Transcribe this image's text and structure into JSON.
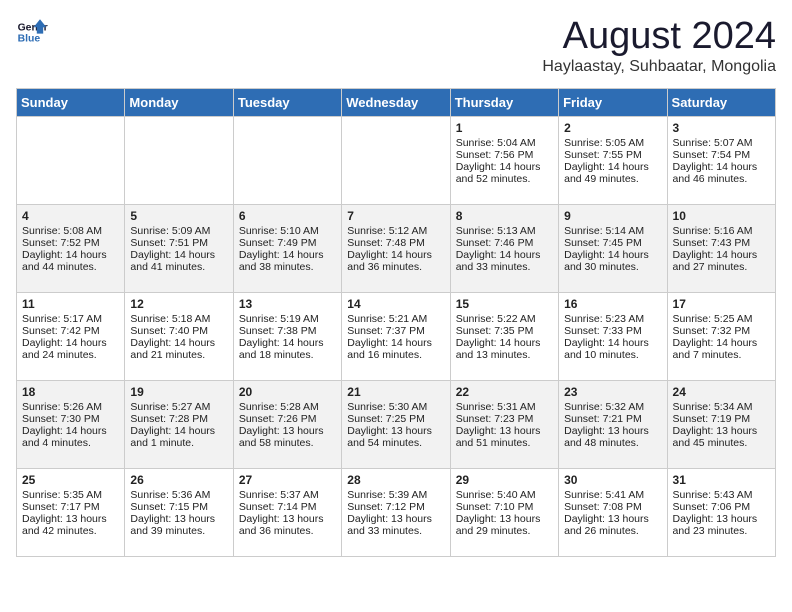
{
  "logo": {
    "line1": "General",
    "line2": "Blue"
  },
  "title": "August 2024",
  "subtitle": "Haylaastay, Suhbaatar, Mongolia",
  "weekdays": [
    "Sunday",
    "Monday",
    "Tuesday",
    "Wednesday",
    "Thursday",
    "Friday",
    "Saturday"
  ],
  "weeks": [
    [
      {
        "day": "",
        "info": ""
      },
      {
        "day": "",
        "info": ""
      },
      {
        "day": "",
        "info": ""
      },
      {
        "day": "",
        "info": ""
      },
      {
        "day": "1",
        "info": "Sunrise: 5:04 AM\nSunset: 7:56 PM\nDaylight: 14 hours\nand 52 minutes."
      },
      {
        "day": "2",
        "info": "Sunrise: 5:05 AM\nSunset: 7:55 PM\nDaylight: 14 hours\nand 49 minutes."
      },
      {
        "day": "3",
        "info": "Sunrise: 5:07 AM\nSunset: 7:54 PM\nDaylight: 14 hours\nand 46 minutes."
      }
    ],
    [
      {
        "day": "4",
        "info": "Sunrise: 5:08 AM\nSunset: 7:52 PM\nDaylight: 14 hours\nand 44 minutes."
      },
      {
        "day": "5",
        "info": "Sunrise: 5:09 AM\nSunset: 7:51 PM\nDaylight: 14 hours\nand 41 minutes."
      },
      {
        "day": "6",
        "info": "Sunrise: 5:10 AM\nSunset: 7:49 PM\nDaylight: 14 hours\nand 38 minutes."
      },
      {
        "day": "7",
        "info": "Sunrise: 5:12 AM\nSunset: 7:48 PM\nDaylight: 14 hours\nand 36 minutes."
      },
      {
        "day": "8",
        "info": "Sunrise: 5:13 AM\nSunset: 7:46 PM\nDaylight: 14 hours\nand 33 minutes."
      },
      {
        "day": "9",
        "info": "Sunrise: 5:14 AM\nSunset: 7:45 PM\nDaylight: 14 hours\nand 30 minutes."
      },
      {
        "day": "10",
        "info": "Sunrise: 5:16 AM\nSunset: 7:43 PM\nDaylight: 14 hours\nand 27 minutes."
      }
    ],
    [
      {
        "day": "11",
        "info": "Sunrise: 5:17 AM\nSunset: 7:42 PM\nDaylight: 14 hours\nand 24 minutes."
      },
      {
        "day": "12",
        "info": "Sunrise: 5:18 AM\nSunset: 7:40 PM\nDaylight: 14 hours\nand 21 minutes."
      },
      {
        "day": "13",
        "info": "Sunrise: 5:19 AM\nSunset: 7:38 PM\nDaylight: 14 hours\nand 18 minutes."
      },
      {
        "day": "14",
        "info": "Sunrise: 5:21 AM\nSunset: 7:37 PM\nDaylight: 14 hours\nand 16 minutes."
      },
      {
        "day": "15",
        "info": "Sunrise: 5:22 AM\nSunset: 7:35 PM\nDaylight: 14 hours\nand 13 minutes."
      },
      {
        "day": "16",
        "info": "Sunrise: 5:23 AM\nSunset: 7:33 PM\nDaylight: 14 hours\nand 10 minutes."
      },
      {
        "day": "17",
        "info": "Sunrise: 5:25 AM\nSunset: 7:32 PM\nDaylight: 14 hours\nand 7 minutes."
      }
    ],
    [
      {
        "day": "18",
        "info": "Sunrise: 5:26 AM\nSunset: 7:30 PM\nDaylight: 14 hours\nand 4 minutes."
      },
      {
        "day": "19",
        "info": "Sunrise: 5:27 AM\nSunset: 7:28 PM\nDaylight: 14 hours\nand 1 minute."
      },
      {
        "day": "20",
        "info": "Sunrise: 5:28 AM\nSunset: 7:26 PM\nDaylight: 13 hours\nand 58 minutes."
      },
      {
        "day": "21",
        "info": "Sunrise: 5:30 AM\nSunset: 7:25 PM\nDaylight: 13 hours\nand 54 minutes."
      },
      {
        "day": "22",
        "info": "Sunrise: 5:31 AM\nSunset: 7:23 PM\nDaylight: 13 hours\nand 51 minutes."
      },
      {
        "day": "23",
        "info": "Sunrise: 5:32 AM\nSunset: 7:21 PM\nDaylight: 13 hours\nand 48 minutes."
      },
      {
        "day": "24",
        "info": "Sunrise: 5:34 AM\nSunset: 7:19 PM\nDaylight: 13 hours\nand 45 minutes."
      }
    ],
    [
      {
        "day": "25",
        "info": "Sunrise: 5:35 AM\nSunset: 7:17 PM\nDaylight: 13 hours\nand 42 minutes."
      },
      {
        "day": "26",
        "info": "Sunrise: 5:36 AM\nSunset: 7:15 PM\nDaylight: 13 hours\nand 39 minutes."
      },
      {
        "day": "27",
        "info": "Sunrise: 5:37 AM\nSunset: 7:14 PM\nDaylight: 13 hours\nand 36 minutes."
      },
      {
        "day": "28",
        "info": "Sunrise: 5:39 AM\nSunset: 7:12 PM\nDaylight: 13 hours\nand 33 minutes."
      },
      {
        "day": "29",
        "info": "Sunrise: 5:40 AM\nSunset: 7:10 PM\nDaylight: 13 hours\nand 29 minutes."
      },
      {
        "day": "30",
        "info": "Sunrise: 5:41 AM\nSunset: 7:08 PM\nDaylight: 13 hours\nand 26 minutes."
      },
      {
        "day": "31",
        "info": "Sunrise: 5:43 AM\nSunset: 7:06 PM\nDaylight: 13 hours\nand 23 minutes."
      }
    ]
  ]
}
